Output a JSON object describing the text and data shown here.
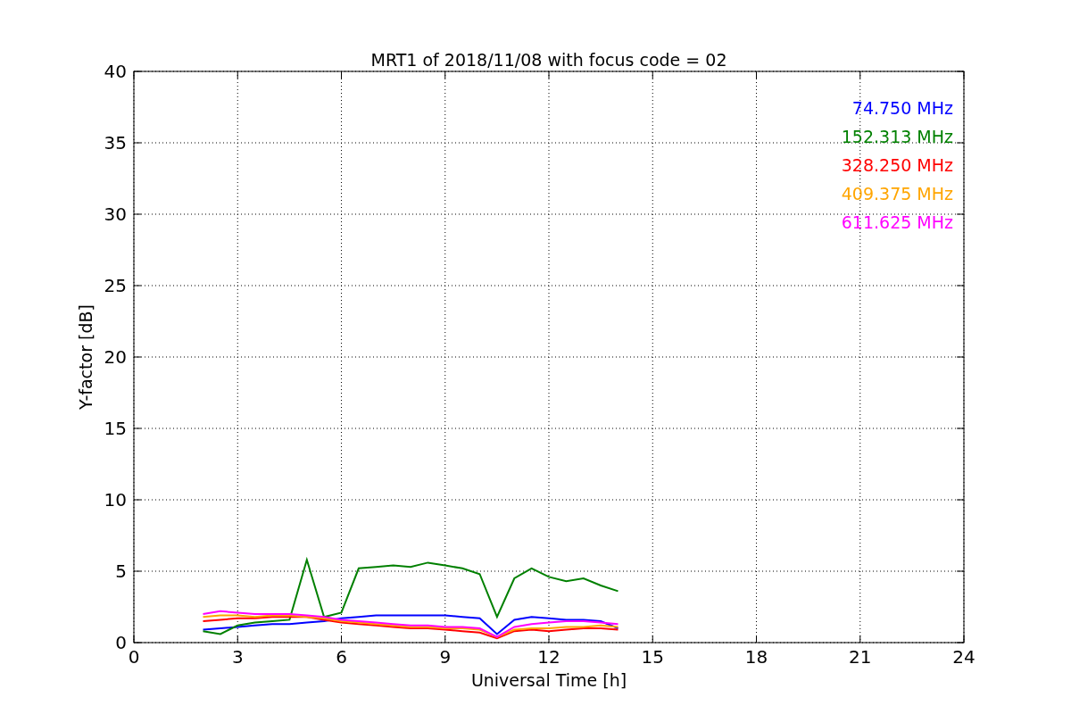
{
  "chart": {
    "chart_data": {
      "type": "line",
      "title": "MRT1 of 2018/11/08 with focus code = 02",
      "xlabel": "Universal Time [h]",
      "ylabel": "Y-factor [dB]",
      "x": [
        2,
        2.5,
        3,
        3.5,
        4,
        4.5,
        5,
        5.5,
        6,
        6.5,
        7,
        7.5,
        8,
        8.5,
        9,
        9.5,
        10,
        10.5,
        11,
        11.5,
        12,
        12.5,
        13,
        13.5,
        14
      ],
      "series": [
        {
          "name": "74.750 MHz",
          "color": "#0000ff",
          "values": [
            0.9,
            1.0,
            1.1,
            1.2,
            1.3,
            1.3,
            1.4,
            1.5,
            1.7,
            1.8,
            1.9,
            1.9,
            1.9,
            1.9,
            1.9,
            1.8,
            1.7,
            0.6,
            1.6,
            1.8,
            1.7,
            1.6,
            1.6,
            1.5,
            1.0
          ]
        },
        {
          "name": "152.313 MHz",
          "color": "#008000",
          "values": [
            0.8,
            0.6,
            1.2,
            1.4,
            1.5,
            1.6,
            5.8,
            1.8,
            2.1,
            5.2,
            5.3,
            5.4,
            5.3,
            5.6,
            5.4,
            5.2,
            4.8,
            1.8,
            4.5,
            5.2,
            4.6,
            4.3,
            4.5,
            4.0,
            3.6
          ]
        },
        {
          "name": "328.250 MHz",
          "color": "#ff0000",
          "values": [
            1.5,
            1.6,
            1.7,
            1.7,
            1.8,
            1.8,
            1.8,
            1.6,
            1.4,
            1.3,
            1.2,
            1.1,
            1.0,
            1.0,
            0.9,
            0.8,
            0.7,
            0.3,
            0.8,
            0.9,
            0.8,
            0.9,
            1.0,
            1.0,
            0.9
          ]
        },
        {
          "name": "409.375 MHz",
          "color": "#ffa500",
          "values": [
            1.8,
            1.9,
            1.9,
            1.8,
            1.9,
            1.9,
            1.8,
            1.7,
            1.5,
            1.4,
            1.3,
            1.2,
            1.1,
            1.1,
            1.0,
            1.0,
            0.9,
            0.4,
            0.9,
            1.0,
            1.0,
            1.1,
            1.1,
            1.2,
            1.1
          ]
        },
        {
          "name": "611.625 MHz",
          "color": "#ff00ff",
          "values": [
            2.0,
            2.2,
            2.1,
            2.0,
            2.0,
            2.0,
            1.9,
            1.8,
            1.6,
            1.5,
            1.4,
            1.3,
            1.2,
            1.2,
            1.1,
            1.1,
            1.0,
            0.4,
            1.1,
            1.3,
            1.4,
            1.5,
            1.5,
            1.4,
            1.3
          ]
        }
      ],
      "xlim": [
        0,
        24
      ],
      "ylim": [
        0,
        40
      ],
      "xticks": [
        0,
        3,
        6,
        9,
        12,
        15,
        18,
        21,
        24
      ],
      "yticks": [
        0,
        5,
        10,
        15,
        20,
        25,
        30,
        35,
        40
      ],
      "grid": true
    }
  }
}
